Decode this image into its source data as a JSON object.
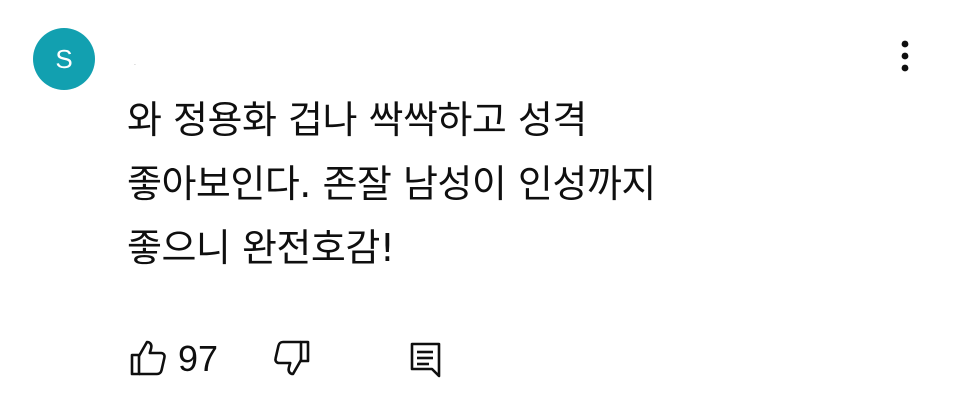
{
  "comment": {
    "author_initial": "S",
    "author_name": ".",
    "text_lines": [
      "와 정용화 겁나 싹싹하고 성격",
      "좋아보인다. 존잘 남성이 인성까지",
      "좋으니 완전호감!"
    ],
    "like_count": "97"
  },
  "icons": {
    "more": "more-vert-icon",
    "like": "thumb-up-icon",
    "dislike": "thumb-down-icon",
    "reply": "reply-comment-icon"
  },
  "colors": {
    "avatar_bg": "#12a0b0",
    "text": "#0f0f0f"
  }
}
